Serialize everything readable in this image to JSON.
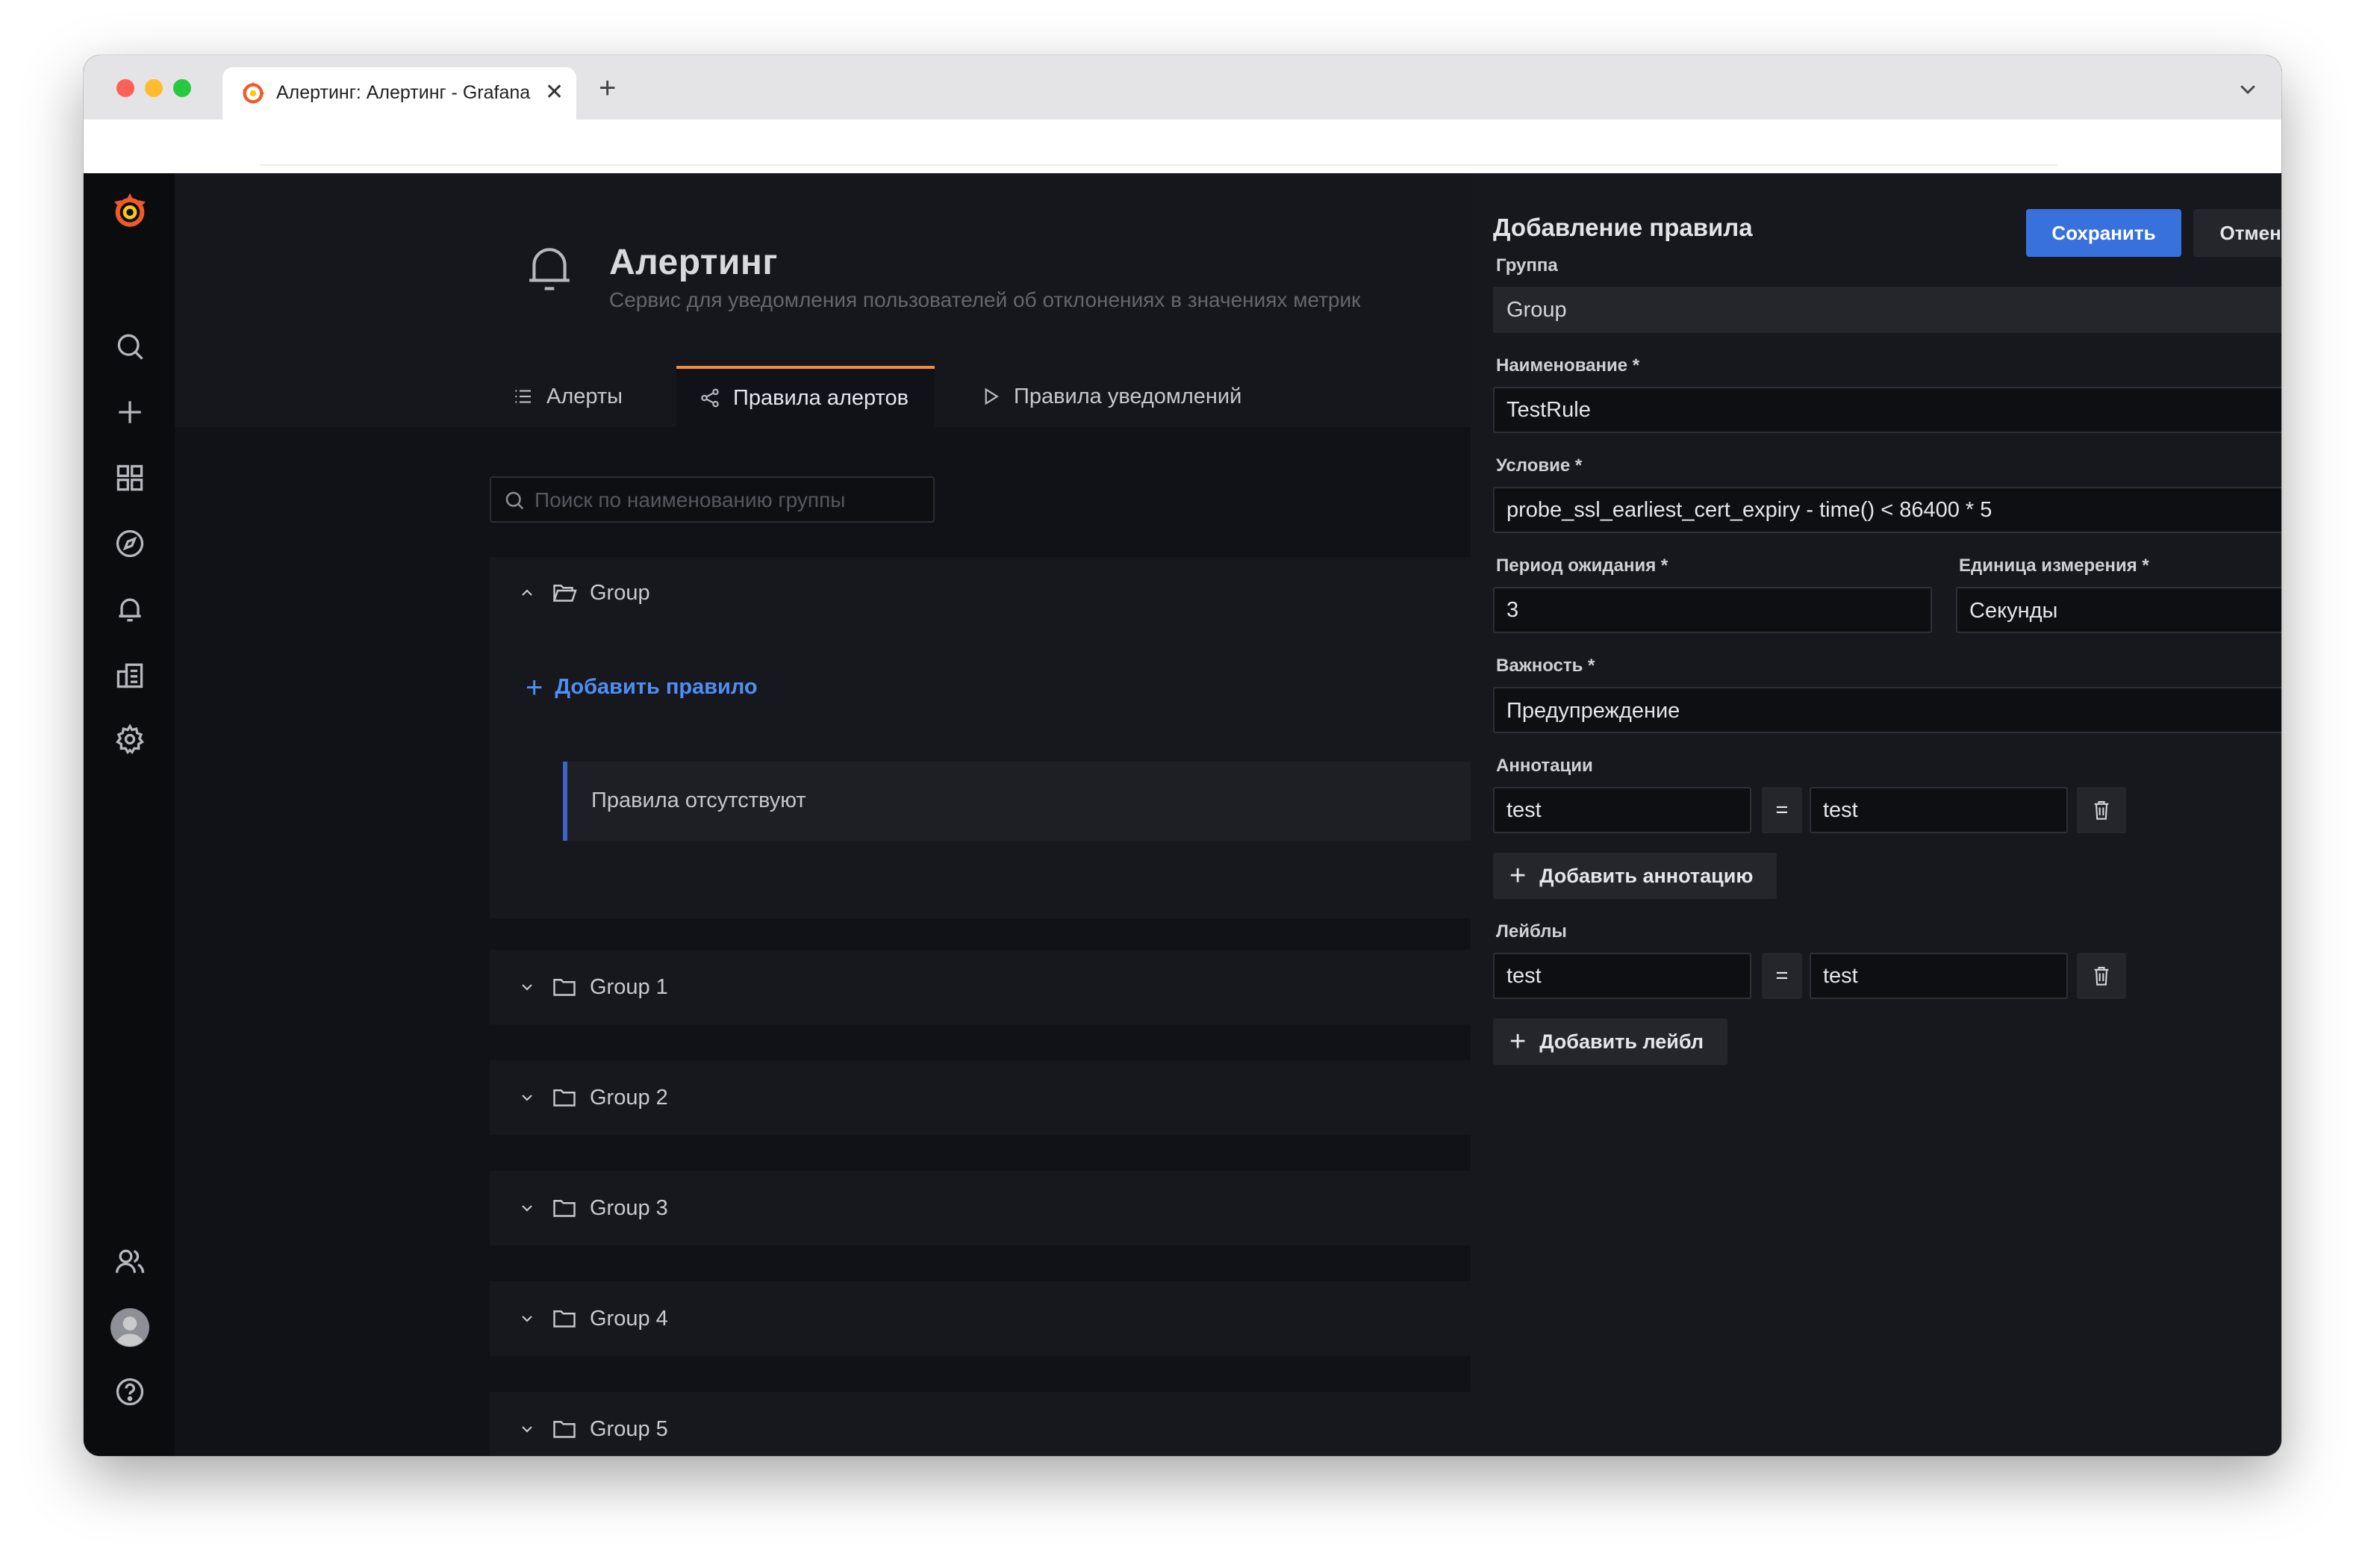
{
  "browser": {
    "tab_title": "Алертинг: Алертинг - Grafana",
    "close_symbol": "✕",
    "new_tab_symbol": "+"
  },
  "sidenav": {
    "icons": [
      "grafana-logo-icon",
      "search-icon",
      "plus-icon",
      "dashboards-icon",
      "explore-icon",
      "bell-icon",
      "reports-icon",
      "gear-icon",
      "users-icon",
      "avatar",
      "help-icon"
    ]
  },
  "header": {
    "title": "Алертинг",
    "subtitle": "Сервис для уведомления пользователей об отклонениях в значениях метрик"
  },
  "tabs": [
    {
      "label": "Алерты",
      "icon": "list-icon",
      "active": false
    },
    {
      "label": "Правила алертов",
      "icon": "share-icon",
      "active": true
    },
    {
      "label": "Правила уведомлений",
      "icon": "play-icon",
      "active": false
    }
  ],
  "search": {
    "placeholder": "Поиск по наименованию группы",
    "value": ""
  },
  "groups": [
    {
      "name": "Group",
      "expanded": true
    },
    {
      "name": "Group 1",
      "expanded": false
    },
    {
      "name": "Group 2",
      "expanded": false
    },
    {
      "name": "Group 3",
      "expanded": false
    },
    {
      "name": "Group 4",
      "expanded": false
    },
    {
      "name": "Group 5",
      "expanded": false
    }
  ],
  "group_expanded": {
    "add_rule_label": "Добавить правило",
    "empty_label": "Правила отсутствуют"
  },
  "drawer": {
    "title": "Добавление правила",
    "save_label": "Сохранить",
    "cancel_label": "Отменить",
    "group": {
      "label": "Группа",
      "value": "Group"
    },
    "name": {
      "label": "Наименование *",
      "value": "TestRule"
    },
    "condition": {
      "label": "Условие *",
      "value": "probe_ssl_earliest_cert_expiry - time() < 86400 * 5"
    },
    "wait_period": {
      "label": "Период ожидания *",
      "value": "3"
    },
    "unit": {
      "label": "Единица измерения *",
      "value": "Секунды"
    },
    "severity": {
      "label": "Важность *",
      "value": "Предупреждение"
    },
    "annotations": {
      "label": "Аннотации",
      "key": "test",
      "eq": "=",
      "value": "test",
      "add_label": "Добавить аннотацию"
    },
    "labels": {
      "label": "Лейблы",
      "key": "test",
      "eq": "=",
      "value": "test",
      "add_label": "Добавить лейбл"
    }
  },
  "colors": {
    "accent_orange": "#f28b35",
    "primary_blue": "#3871dc",
    "link_blue": "#4f8ef5",
    "background": "#111217"
  }
}
